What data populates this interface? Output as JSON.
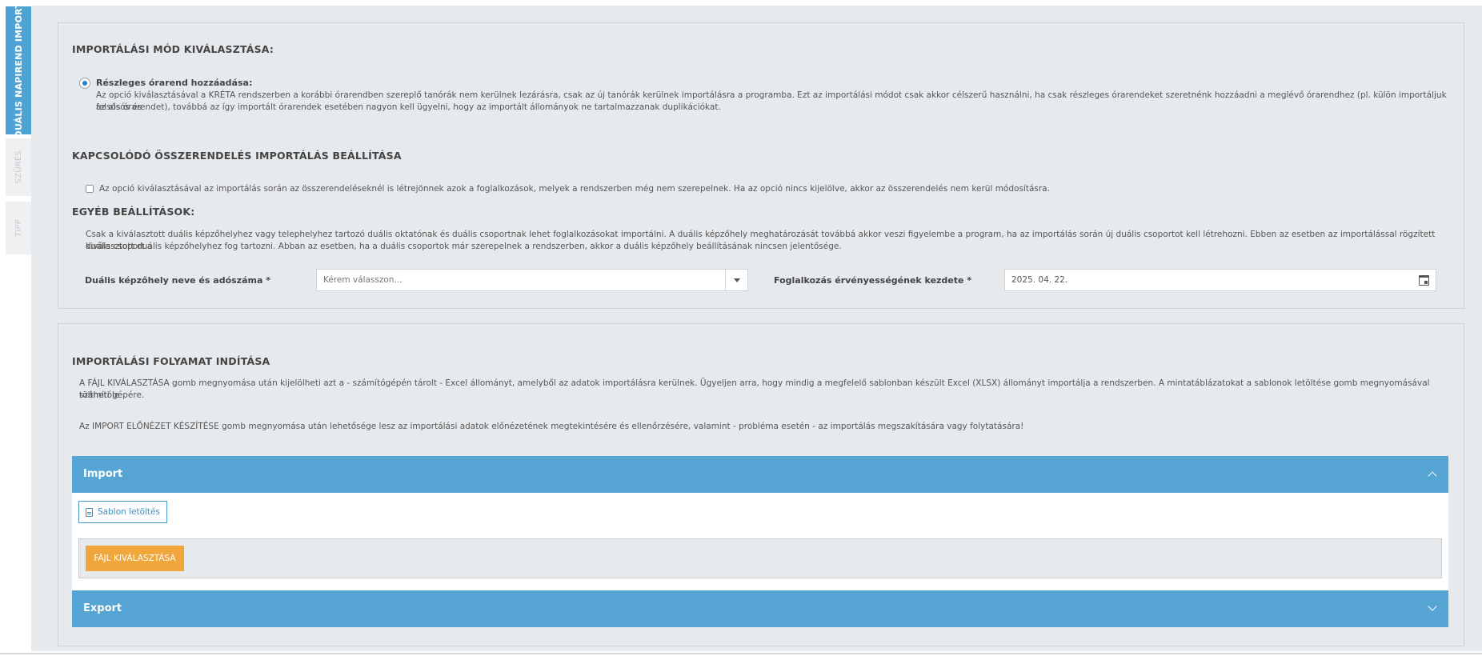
{
  "sidebar": {
    "tabs": [
      {
        "label": "DUÁLIS NAPIREND IMPORT",
        "active": true
      },
      {
        "label": "SZŰRÉS",
        "active": false
      },
      {
        "label": "TIPP",
        "active": false
      }
    ]
  },
  "settings": {
    "mode_heading": "IMPORTÁLÁSI MÓD KIVÁLASZTÁSA:",
    "partial_label": "Részleges órarend hozzáadása:",
    "partial_desc_1": "Az opció kiválasztásával a KRÉTA rendszerben a korábbi órarendben szereplő tanórák nem kerülnek lezárásra, csak az új tanórák kerülnek importálásra a programba. Ezt az importálási módot csak akkor célszerű használni, ha csak részleges órarendeket szeretnénk hozzáadni a meglévő órarendhez (pl. külön importáljuk az alsós és",
    "partial_desc_2": "felsős órarendet), továbbá az így importált órarendek esetében nagyon kell ügyelni, hogy az importált állományok ne tartalmazzanak duplikációkat.",
    "link_heading": "KAPCSOLÓDÓ ÖSSZERENDELÉS IMPORTÁLÁS BEÁLLÍTÁSA",
    "link_checkbox_label": "Az opció kiválasztásával az importálás során az összerendeléseknél is létrejönnek azok a foglalkozások, melyek a rendszerben még nem szerepelnek. Ha az opció nincs kijelölve, akkor az összerendelés nem kerül módosításra.",
    "other_heading": "EGYÉB BEÁLLÍTÁSOK:",
    "other_desc_1": "Csak a kiválasztott duális képzőhelyhez vagy telephelyhez tartozó duális oktatónak és duális csoportnak lehet foglalkozásokat importálni. A duális képzőhely meghatározását továbbá akkor veszi figyelembe a program, ha az importálás során új duális csoportot kell létrehozni. Ebben az esetben az importálással rögzített duális csoport a",
    "other_desc_2": "kiválasztott duális képzőhelyhez fog tartozni. Abban az esetben, ha a duális csoportok már szerepelnek a rendszerben, akkor a duális képzőhely beállításának nincsen jelentősége.",
    "place_label": "Duális képzőhely neve és adószáma *",
    "place_placeholder": "Kérem válasszon...",
    "start_label": "Foglalkozás érvényességének kezdete *",
    "start_value": "2025. 04. 22."
  },
  "process": {
    "heading": "IMPORTÁLÁSI FOLYAMAT INDÍTÁSA",
    "desc_1a": "A FÁJL KIVÁLASZTÁSA gomb megnyomása után kijelölheti azt a - számítógépén tárolt - Excel állományt, amelyből az adatok importálásra kerülnek. Ügyeljen arra, hogy mindig a megfelelő sablonban készült Excel (XLSX) állományt importálja a rendszerben. A mintatáblázatokat a sablonok letöltése gomb megnyomásával töltheti le",
    "desc_1b": "számítógépére.",
    "desc_2": "Az IMPORT ELŐNÉZET KÉSZÍTÉSE gomb megnyomása után lehetősége lesz az importálási adatok előnézetének megtekintésére és ellenőrzésére, valamint - probléma esetén - az importálás megszakítására vagy folytatására!",
    "import_title": "Import",
    "template_button": "Sablon letöltés",
    "file_button": "FÁJL KIVÁLASZTÁSA",
    "export_title": "Export"
  }
}
